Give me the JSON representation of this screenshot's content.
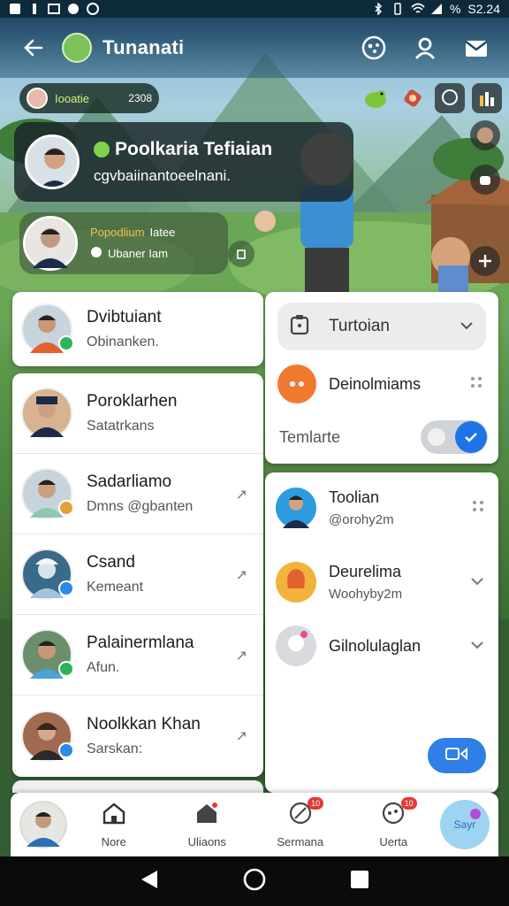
{
  "status_bar": {
    "time": "S2.24",
    "battery": "%"
  },
  "header": {
    "title": "Tunanati"
  },
  "chip": {
    "label": "Iooatie",
    "count": "2308"
  },
  "profile": {
    "name": "Poolkaria Tefiaian",
    "subtitle": "cgvbaiinantoeelnani."
  },
  "profile2": {
    "line1": "Popodlium",
    "line1_tag": "Iatee",
    "line2": "Ubaner Iam"
  },
  "left_top": {
    "name": "Dvibtuiant",
    "sub": "Obinanken."
  },
  "contacts": [
    {
      "name": "Poroklarhen",
      "sub": "Satatrkans",
      "badge_color": "#c6a15b",
      "avatar_color": "#d7b48f"
    },
    {
      "name": "Sadarliamo",
      "sub": "Dmns @gbanten",
      "badge_color": "#e0a03a",
      "avatar_color": "#c8d4db"
    },
    {
      "name": "Csand",
      "sub": "Kemeant",
      "badge_color": "#2c8be6",
      "avatar_color": "#3a6a8a"
    },
    {
      "name": "Palainermlana",
      "sub": "Afun.",
      "badge_color": "#2fb35a",
      "avatar_color": "#6a8f6a"
    },
    {
      "name": "Noolkkan Khan",
      "sub": "Sarskan:",
      "badge_color": "#2c8be6",
      "avatar_color": "#a06a50"
    }
  ],
  "right_panel": {
    "dropdown_label": "Turtoian",
    "item_label": "Deinolmiams",
    "toggle_label": "Temlarte",
    "toggle_on": true
  },
  "right_list": [
    {
      "name": "Toolian",
      "sub": "@orohy2m",
      "tail": "dots",
      "avatar_color": "#2d9be0"
    },
    {
      "name": "Deurelima",
      "sub": "Woohyby2m",
      "tail": "check",
      "avatar_color": "#f3b23b"
    },
    {
      "name": "Gilnolulaglan",
      "sub": "",
      "tail": "check",
      "avatar_color": "#d8dade"
    }
  ],
  "bottom_nav": [
    {
      "label": "Nore",
      "icon": "house-icon",
      "badge": ""
    },
    {
      "label": "Uliaons",
      "icon": "home-icon",
      "badge": ""
    },
    {
      "label": "Sermana",
      "icon": "leaf-icon",
      "badge": "10"
    },
    {
      "label": "Uerta",
      "icon": "clock-icon",
      "badge": "10"
    }
  ],
  "fab_label": "Sayr",
  "colors": {
    "accent": "#1e74e6",
    "danger": "#e53935",
    "header": "#1b4a63"
  }
}
